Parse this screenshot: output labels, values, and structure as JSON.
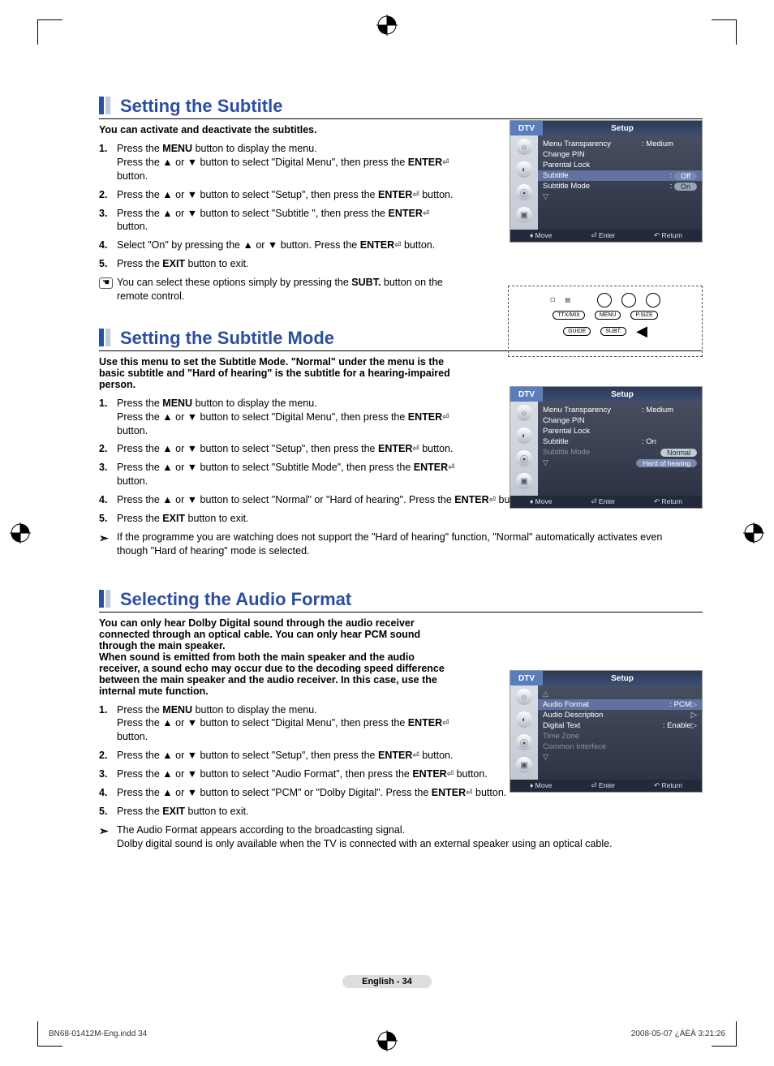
{
  "page": {
    "footer_left": "BN68-01412M-Eng.indd   34",
    "footer_right": "2008-05-07   ¿ÀÈÄ 3:21:26",
    "page_label": "English - 34"
  },
  "osd_common": {
    "dtv": "DTV",
    "setup": "Setup",
    "move": "Move",
    "enter": "Enter",
    "return": "Return"
  },
  "section1": {
    "title": "Setting the Subtitle",
    "intro": "You can activate and deactivate the subtitles.",
    "steps": [
      {
        "n": "1.",
        "t": "Press the <b>MENU</b> button to display the menu.<br>Press the ▲ or ▼ button to select \"Digital Menu\", then press the <b>ENTER</b><span class='enter-icon'>⏎</span> button."
      },
      {
        "n": "2.",
        "t": "Press the ▲ or ▼ button to select \"Setup\", then press the <b>ENTER</b><span class='enter-icon'>⏎</span> button."
      },
      {
        "n": "3.",
        "t": "Press the ▲ or ▼ button to select \"Subtitle \", then press the <b>ENTER</b><span class='enter-icon'>⏎</span> button."
      },
      {
        "n": "4.",
        "t": "Select \"On\" by pressing the ▲ or ▼ button. Press the <b>ENTER</b><span class='enter-icon'>⏎</span> button."
      },
      {
        "n": "5.",
        "t": "Press the <b>EXIT</b> button to exit."
      },
      {
        "n": "<span class='note-icon'>☚</span>",
        "t": "You can select these options simply by pressing the <b>SUBT.</b> button on the remote control."
      }
    ],
    "osd": {
      "items": [
        {
          "lab": "Menu Transparency",
          "val": ": Medium"
        },
        {
          "lab": "Change PIN",
          "val": ""
        },
        {
          "lab": "Parental Lock",
          "val": ""
        }
      ],
      "subtitle_lab": "Subtitle",
      "subtitle_colon": ":",
      "subtitle_off": "Off",
      "mode_lab": "Subtitle  Mode",
      "mode_colon": ":",
      "mode_on": "On",
      "tri": "▽"
    },
    "remote_buttons": {
      "ttx": "TTX/MIX",
      "menu": "MENU",
      "psize": "P.SIZE",
      "guide": "GUIDE",
      "subt": "SUBT."
    }
  },
  "section2": {
    "title": "Setting the Subtitle Mode",
    "intro": "Use this menu to set the Subtitle Mode. \"Normal\" under the menu is the basic subtitle and \"Hard of hearing\" is the subtitle for a hearing-impaired person.",
    "steps": [
      {
        "n": "1.",
        "t": "Press the <b>MENU</b> button to display the menu.<br>Press the ▲ or ▼ button to select \"Digital Menu\", then press the <b>ENTER</b><span class='enter-icon'>⏎</span> button."
      },
      {
        "n": "2.",
        "t": "Press the ▲ or ▼ button to select \"Setup\", then press the <b>ENTER</b><span class='enter-icon'>⏎</span> button."
      },
      {
        "n": "3.",
        "t": "Press the ▲ or ▼ button to select \"Subtitle  Mode\", then press the <b>ENTER</b><span class='enter-icon'>⏎</span> button."
      },
      {
        "n": "4.",
        "t": "Press the ▲ or ▼ button to select \"Normal\" or \"Hard of hearing\". Press the <b>ENTER</b><span class='enter-icon'>⏎</span> button."
      },
      {
        "n": "5.",
        "t": "Press the <b>EXIT</b> button to exit."
      },
      {
        "n": "<span class='arrow-note'>➣</span>",
        "t": "If the programme you are watching does not support the \"Hard of hearing\" function, \"Normal\" automatically activates even though \"Hard of hearing\" mode is selected."
      }
    ],
    "osd": {
      "items": [
        {
          "lab": "Menu Transparency",
          "val": ": Medium"
        },
        {
          "lab": "Change PIN",
          "val": ""
        },
        {
          "lab": "Parental Lock",
          "val": ""
        },
        {
          "lab": "Subtitle",
          "val": ": On"
        }
      ],
      "mode_lab": "Subtitle  Mode",
      "mode_colon": ":",
      "normal": "Normal",
      "hard": "Hard of hearing",
      "tri": "▽"
    }
  },
  "section3": {
    "title": "Selecting the Audio Format",
    "intro": "You can only hear Dolby Digital sound through the audio receiver connected through an optical cable. You can only hear PCM sound through the main speaker.\nWhen sound is emitted from both the main speaker and the audio receiver, a sound echo may occur due to the decoding speed difference between the main speaker and the audio receiver. In this case, use the internal mute function.",
    "steps": [
      {
        "n": "1.",
        "t": "Press the <b>MENU</b> button to display the menu.<br>Press the ▲ or ▼ button to select \"Digital Menu\", then press the <b>ENTER</b><span class='enter-icon'>⏎</span> button."
      },
      {
        "n": "2.",
        "t": "Press the ▲ or ▼ button to select \"Setup\", then press the <b>ENTER</b><span class='enter-icon'>⏎</span> button."
      },
      {
        "n": "3.",
        "t": "Press the ▲ or ▼ button to select \"Audio Format\", then press the <b>ENTER</b><span class='enter-icon'>⏎</span> button."
      },
      {
        "n": "4.",
        "t": "Press the ▲ or ▼ button to select \"PCM\" or \"Dolby Digital\". Press the <b>ENTER</b><span class='enter-icon'>⏎</span> button."
      },
      {
        "n": "5.",
        "t": "Press the <b>EXIT</b> button to exit."
      },
      {
        "n": "<span class='arrow-note'>➣</span>",
        "t": "The Audio Format appears according to the broadcasting signal.<br>Dolby digital sound is only available when the TV is connected with an external speaker using an optical cable."
      }
    ],
    "osd": {
      "tri_up": "△",
      "af_lab": "Audio Format",
      "af_val": ": PCM",
      "ad_lab": "Audio Description",
      "dt_lab": "Digital Text",
      "dt_val": ": Enable",
      "tz_lab": "Time Zone",
      "ci_lab": "Common Interfece",
      "tri": "▽"
    }
  }
}
